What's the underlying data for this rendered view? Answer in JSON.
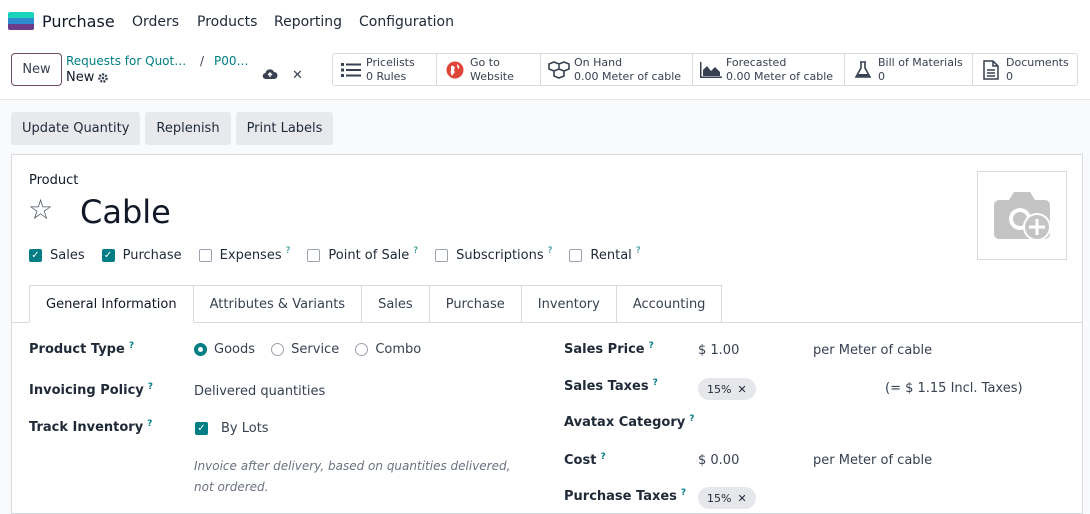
{
  "app": {
    "name": "Purchase",
    "logo_colors": [
      "#1ad3bb",
      "#2f8bd1",
      "#6c3b8a"
    ]
  },
  "menu": [
    "Orders",
    "Products",
    "Reporting",
    "Configuration"
  ],
  "control": {
    "new_label": "New",
    "breadcrumb": {
      "parent": "Requests for Quot…",
      "separator": "/",
      "second": "P00…",
      "current": "New"
    }
  },
  "stat_buttons": [
    {
      "line1": "Pricelists",
      "line2": "0 Rules",
      "icon": "list-icon"
    },
    {
      "line1": "Go to",
      "line2": "Website",
      "icon": "globe-icon"
    },
    {
      "line1": "On Hand",
      "line2": "0.00 Meter of cable",
      "icon": "cubes-icon"
    },
    {
      "line1": "Forecasted",
      "line2": "0.00 Meter of cable",
      "icon": "area-chart-icon"
    },
    {
      "line1": "Bill of Materials",
      "line2": "0",
      "icon": "flask-icon"
    },
    {
      "line1": "Documents",
      "line2": "0",
      "icon": "document-icon"
    }
  ],
  "actions": [
    "Update Quantity",
    "Replenish",
    "Print Labels"
  ],
  "product": {
    "label": "Product",
    "name": "Cable",
    "flags": [
      {
        "label": "Sales",
        "checked": true,
        "help": ""
      },
      {
        "label": "Purchase",
        "checked": true,
        "help": ""
      },
      {
        "label": "Expenses",
        "checked": false,
        "help": "?"
      },
      {
        "label": "Point of Sale",
        "checked": false,
        "help": "?"
      },
      {
        "label": "Subscriptions",
        "checked": false,
        "help": "?"
      },
      {
        "label": "Rental",
        "checked": false,
        "help": "?"
      }
    ]
  },
  "tabs": [
    "General Information",
    "Attributes & Variants",
    "Sales",
    "Purchase",
    "Inventory",
    "Accounting"
  ],
  "general": {
    "product_type_label": "Product Type",
    "product_type_options": [
      "Goods",
      "Service",
      "Combo"
    ],
    "product_type_selected": "Goods",
    "invoicing_policy_label": "Invoicing Policy",
    "invoicing_policy_value": "Delivered quantities",
    "track_inventory_label": "Track Inventory",
    "track_inventory_value": "By Lots",
    "note": "Invoice after delivery, based on quantities delivered, not ordered.",
    "sales_price_label": "Sales Price",
    "sales_price_value": "$ 1.00",
    "sales_price_unit": "per Meter of cable",
    "sales_taxes_label": "Sales Taxes",
    "sales_tax_tag": "15%",
    "sales_taxes_incl": "(= $ 1.15 Incl. Taxes)",
    "avatax_label": "Avatax Category",
    "cost_label": "Cost",
    "cost_value": "$ 0.00",
    "cost_unit": "per Meter of cable",
    "purchase_taxes_label": "Purchase Taxes",
    "purchase_tax_tag": "15%"
  },
  "help_mark": "?",
  "accent_color": "#017e84",
  "brand_color": "#714b67"
}
